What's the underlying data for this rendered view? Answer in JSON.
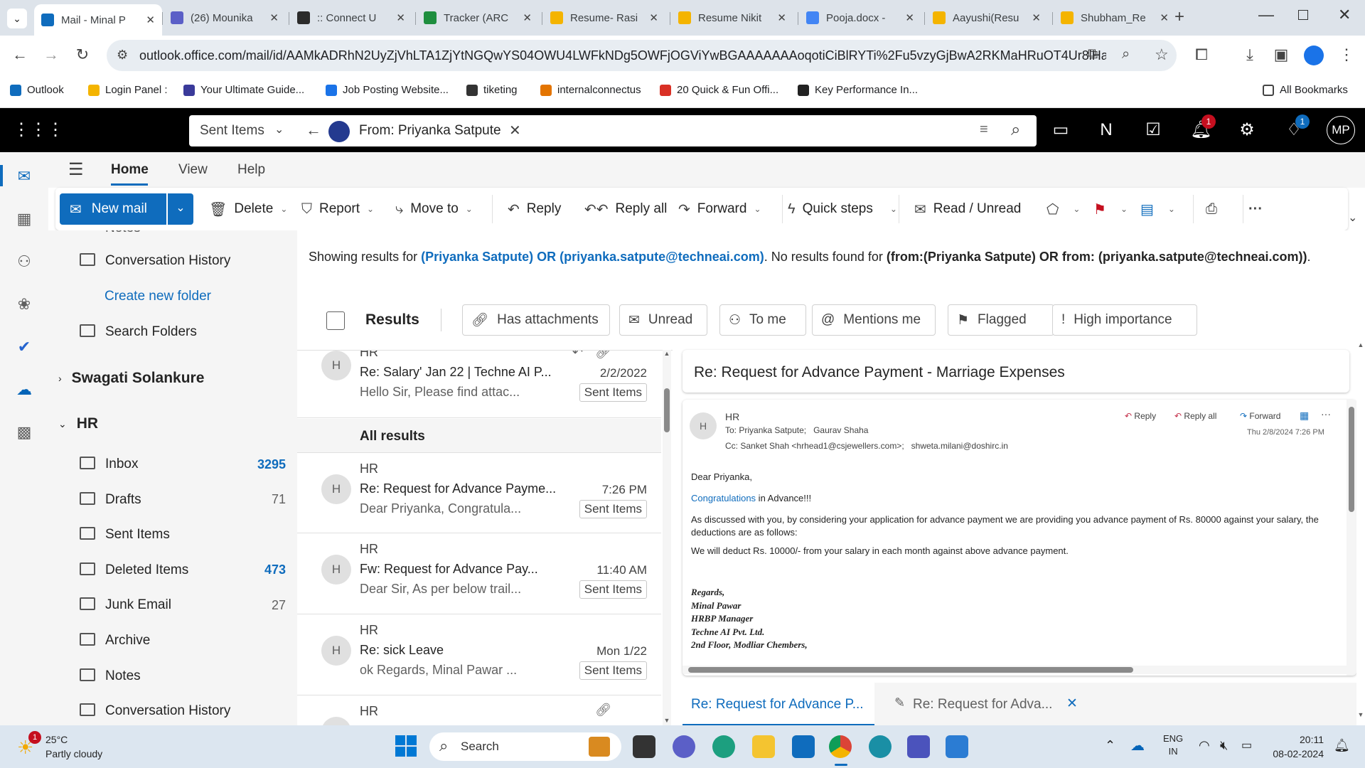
{
  "browser": {
    "tabs": [
      {
        "label": "Mail - Minal P",
        "color": "#0f6cbd"
      },
      {
        "label": "(26) Mounika",
        "color": "#5b5fc7"
      },
      {
        "label": ":: Connect U",
        "color": "#2b2b2b"
      },
      {
        "label": "Tracker (ARC",
        "color": "#1e8e3e"
      },
      {
        "label": "Resume- Rasi",
        "color": "#f4b400"
      },
      {
        "label": "Resume Nikit",
        "color": "#f4b400"
      },
      {
        "label": "Pooja.docx -",
        "color": "#4285f4"
      },
      {
        "label": "Aayushi(Resu",
        "color": "#f4b400"
      },
      {
        "label": "Shubham_Re",
        "color": "#f4b400"
      }
    ],
    "new_tab": "+",
    "url": "outlook.office.com/mail/id/AAMkADRhN2UyZjVhLTA1ZjYtNGQwYS04OWU4LWFkNDg5OWFjOGViYwBGAAAAAAAoqotiCiBlRYTi%2Fu5vzyGjBwA2RKMaHRuOT4Ur8lHaEyR...",
    "bookmarks": [
      "Outlook",
      "Login Panel :",
      "Your Ultimate Guide...",
      "Job Posting Website...",
      "tiketing",
      "internalconnectus",
      "20 Quick & Fun Offi...",
      "Key Performance In..."
    ],
    "all_bookmarks": "All Bookmarks"
  },
  "outlook": {
    "search": {
      "scope": "Sent Items",
      "filter_chip": "From: Priyanka Satpute"
    },
    "notification_count": "1",
    "tips_count": "1",
    "profile_initials": "MP"
  },
  "ribbon": {
    "tabs": [
      "Home",
      "View",
      "Help"
    ],
    "new_mail": "New mail",
    "delete": "Delete",
    "report": "Report",
    "move_to": "Move to",
    "reply": "Reply",
    "reply_all": "Reply all",
    "forward": "Forward",
    "quick_steps": "Quick steps",
    "read_unread": "Read / Unread"
  },
  "folders": {
    "partial_top": "Notes",
    "items_top": [
      {
        "label": "Conversation History"
      }
    ],
    "create_new": "Create new folder",
    "search_folders": "Search Folders",
    "account1": "Swagati Solankure",
    "account2": "HR",
    "hr_folders": [
      {
        "label": "Inbox",
        "count": "3295",
        "bold": true
      },
      {
        "label": "Drafts",
        "count": "71",
        "bold": false
      },
      {
        "label": "Sent Items",
        "count": "",
        "bold": false
      },
      {
        "label": "Deleted Items",
        "count": "473",
        "bold": true
      },
      {
        "label": "Junk Email",
        "count": "27",
        "bold": false
      },
      {
        "label": "Archive",
        "count": "",
        "bold": false
      },
      {
        "label": "Notes",
        "count": "",
        "bold": false
      },
      {
        "label": "Conversation History",
        "count": "",
        "bold": false
      }
    ]
  },
  "results": {
    "showing_prefix": "Showing results for ",
    "showing_query": "(Priyanka Satpute) OR (priyanka.satpute@techneai.com)",
    "no_results_prefix": ". No results found for ",
    "no_results_query": "(from:(Priyanka Satpute) OR from: (priyanka.satpute@techneai.com))",
    "suffix": ".",
    "results_label": "Results",
    "filters": [
      "Has attachments",
      "Unread",
      "To me",
      "Mentions me",
      "Flagged",
      "High importance"
    ],
    "all_results": "All results"
  },
  "messages": [
    {
      "initial": "H",
      "sender": "HR",
      "subject": "Re: Salary' Jan 22 | Techne AI P...",
      "date": "2/2/2022",
      "preview": "Hello Sir, Please find attac...",
      "folder": "Sent Items"
    },
    {
      "initial": "H",
      "sender": "HR",
      "subject": "Re: Request for Advance Payme...",
      "date": "7:26 PM",
      "preview": "Dear Priyanka, Congratula...",
      "folder": "Sent Items"
    },
    {
      "initial": "H",
      "sender": "HR",
      "subject": "Fw: Request for Advance Pay...",
      "date": "11:40 AM",
      "preview": "Dear Sir, As per below trail...",
      "folder": "Sent Items"
    },
    {
      "initial": "H",
      "sender": "HR",
      "subject": "Re: sick Leave",
      "date": "Mon 1/22",
      "preview": "ok Regards, Minal Pawar ...",
      "folder": "Sent Items"
    },
    {
      "initial": "H",
      "sender": "HR",
      "subject": "",
      "date": "",
      "preview": "",
      "folder": ""
    }
  ],
  "reading": {
    "title": "Re: Request for Advance Payment - Marriage Expenses",
    "from": "HR",
    "initial": "H",
    "to_label": "To:",
    "to": "Priyanka Satpute;   Gaurav Shaha",
    "cc_label": "Cc:",
    "cc": "Sanket Shah <hrhead1@csjewellers.com>;   shweta.milani@doshirc.in",
    "datetime": "Thu 2/8/2024 7:26 PM",
    "reply": "Reply",
    "reply_all": "Reply all",
    "forward": "Forward",
    "greeting": "Dear Priyanka,",
    "congrats_link": "Congratulations",
    "congrats_rest": " in Advance!!!",
    "para1": "As discussed with you, by considering your application for advance payment we are providing you advance payment of Rs. 80000 against your salary, the deductions are as follows:",
    "para2": "We will deduct Rs. 10000/- from your salary in each month against above advance payment.",
    "signature": [
      "Regards,",
      "Minal Pawar",
      "HRBP Manager",
      "Techne AI Pvt. Ltd.",
      "2nd Floor, Modliar Chembers,"
    ]
  },
  "drafts": {
    "tab1": "Re: Request for Advance P...",
    "tab2": "Re: Request for Adva..."
  },
  "taskbar": {
    "weather_temp": "25°C",
    "weather_desc": "Partly cloudy",
    "weather_badge": "1",
    "search": "Search",
    "lang1": "ENG",
    "lang2": "IN",
    "time": "20:11",
    "date": "08-02-2024"
  }
}
